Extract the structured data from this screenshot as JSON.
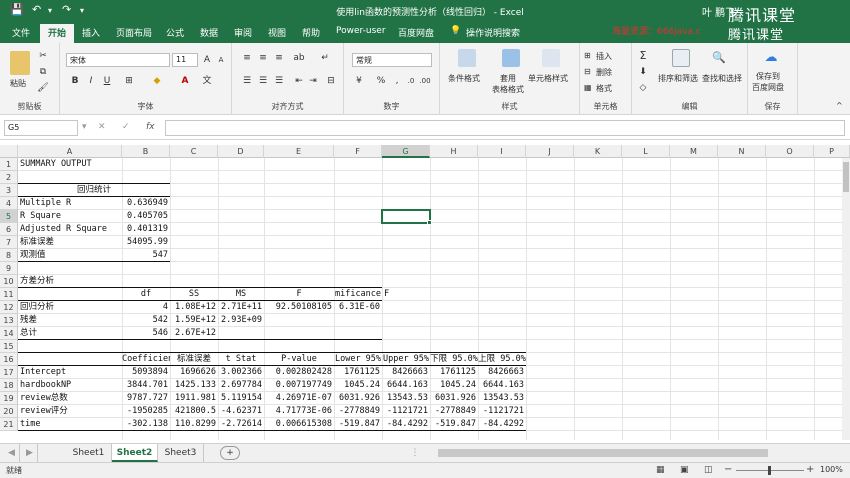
{
  "titlebar": {
    "title": "使用lin函数的预测性分析（线性回归） - Excel",
    "user": "叶 鹏飞",
    "watermark": "腾讯课堂",
    "icons": [
      "save-icon",
      "undo-icon",
      "redo-icon",
      "customize-icon"
    ]
  },
  "ribbon_tabs": {
    "file": "文件",
    "home": "开始",
    "insert": "插入",
    "page_layout": "页面布局",
    "formulas": "公式",
    "data": "数据",
    "review": "审阅",
    "view": "视图",
    "help": "帮助",
    "power_user": "Power-user",
    "baidu": "百度网盘",
    "tell_me": "操作说明搜索",
    "watermark_text": "海量资源：666java.c"
  },
  "ribbon": {
    "clipboard": {
      "paste": "粘贴",
      "label": "剪贴板"
    },
    "font": {
      "name": "宋体",
      "size": "11",
      "label": "字体"
    },
    "alignment": {
      "label": "对齐方式"
    },
    "number": {
      "format": "常规",
      "label": "数字"
    },
    "styles": {
      "cond": "条件格式",
      "table": "套用\n表格格式",
      "cell": "单元格样式",
      "label": "样式"
    },
    "cells": {
      "insert": "插入",
      "delete": "删除",
      "format": "格式",
      "label": "单元格"
    },
    "editing": {
      "sort": "排序和筛选",
      "find": "查找和选择",
      "label": "编辑"
    },
    "save": {
      "button": "保存到\n百度网盘",
      "label": "保存"
    }
  },
  "formula_bar": {
    "name_box": "G5",
    "cancel": "✕",
    "enter": "✓",
    "fx": "fx",
    "value": ""
  },
  "columns": [
    "A",
    "B",
    "C",
    "D",
    "E",
    "F",
    "G",
    "H",
    "I",
    "J",
    "K",
    "L",
    "M",
    "N",
    "O",
    "P"
  ],
  "selected_column": "G",
  "selected_row": "5",
  "rows": [
    "1",
    "2",
    "3",
    "4",
    "5",
    "6",
    "7",
    "8",
    "9",
    "10",
    "11",
    "12",
    "13",
    "14",
    "15",
    "16",
    "17",
    "18",
    "19",
    "20",
    "21"
  ],
  "sheet": {
    "r1": {
      "a": "SUMMARY OUTPUT"
    },
    "r3": {
      "a": "回归统计"
    },
    "r4": {
      "a": "Multiple R",
      "b": "0.636949"
    },
    "r5": {
      "a": "R Square",
      "b": "0.405705"
    },
    "r6": {
      "a": "Adjusted R Square",
      "b": "0.401319"
    },
    "r7": {
      "a": "标准误差",
      "b": "54095.99"
    },
    "r8": {
      "a": "观测值",
      "b": "547"
    },
    "r10": {
      "a": "方差分析"
    },
    "r11": {
      "b": "df",
      "c": "SS",
      "d": "MS",
      "e": "F",
      "f": "mificance",
      "g": "F"
    },
    "r12": {
      "a": "回归分析",
      "b": "4",
      "c": "1.08E+12",
      "d": "2.71E+11",
      "e": "92.50108105",
      "f": "6.31E-60"
    },
    "r13": {
      "a": "残差",
      "b": "542",
      "c": "1.59E+12",
      "d": "2.93E+09"
    },
    "r14": {
      "a": "总计",
      "b": "546",
      "c": "2.67E+12"
    },
    "r16": {
      "b": "Coefficien",
      "c": "标准误差",
      "d": "t Stat",
      "e": "P-value",
      "f": "Lower 95%",
      "g": "Upper 95%",
      "h": "下限 95.0%",
      "i": "上限 95.0%"
    },
    "r17": {
      "a": "Intercept",
      "b": "5093894",
      "c": "1696626",
      "d": "3.002366",
      "e": "0.002802428",
      "f": "1761125",
      "g": "8426663",
      "h": "1761125",
      "i": "8426663"
    },
    "r18": {
      "a": "hardbookNP",
      "b": "3844.701",
      "c": "1425.133",
      "d": "2.697784",
      "e": "0.007197749",
      "f": "1045.24",
      "g": "6644.163",
      "h": "1045.24",
      "i": "6644.163"
    },
    "r19": {
      "a": "review总数",
      "b": "9787.727",
      "c": "1911.981",
      "d": "5.119154",
      "e": "4.26971E-07",
      "f": "6031.926",
      "g": "13543.53",
      "h": "6031.926",
      "i": "13543.53"
    },
    "r20": {
      "a": "review评分",
      "b": "-1950285",
      "c": "421800.5",
      "d": "-4.62371",
      "e": "4.71773E-06",
      "f": "-2778849",
      "g": "-1121721",
      "h": "-2778849",
      "i": "-1121721"
    },
    "r21": {
      "a": "time",
      "b": "-302.138",
      "c": "110.8299",
      "d": "-2.72614",
      "e": "0.006615308",
      "f": "-519.847",
      "g": "-84.4292",
      "h": "-519.847",
      "i": "-84.4292"
    }
  },
  "sheet_tabs": [
    "Sheet1",
    "Sheet2",
    "Sheet3"
  ],
  "active_sheet": "Sheet2",
  "add_sheet": "+",
  "status": {
    "ready": "就绪",
    "zoom": "100%"
  },
  "colors": {
    "excel_green": "#217346",
    "ribbon_bg": "#f3f3f3"
  }
}
